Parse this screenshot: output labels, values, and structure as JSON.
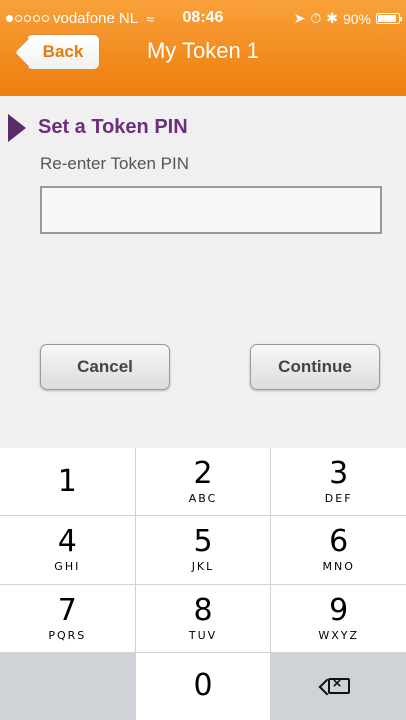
{
  "status_bar": {
    "carrier": "vodafone NL",
    "time": "08:46",
    "battery": "90%",
    "signal_filled": 1,
    "signal_total": 5,
    "icons": [
      "wifi-icon",
      "location-arrow-icon",
      "alarm-icon",
      "bluetooth-icon",
      "battery-icon"
    ]
  },
  "nav": {
    "back_label": "Back",
    "title": "My Token 1"
  },
  "form": {
    "section_title": "Set a Token PIN",
    "field_label": "Re-enter Token PIN",
    "pin_value": "",
    "cancel_label": "Cancel",
    "continue_label": "Continue"
  },
  "keypad": {
    "keys": [
      {
        "digit": "1",
        "letters": ""
      },
      {
        "digit": "2",
        "letters": "ABC"
      },
      {
        "digit": "3",
        "letters": "DEF"
      },
      {
        "digit": "4",
        "letters": "GHI"
      },
      {
        "digit": "5",
        "letters": "JKL"
      },
      {
        "digit": "6",
        "letters": "MNO"
      },
      {
        "digit": "7",
        "letters": "PQRS"
      },
      {
        "digit": "8",
        "letters": "TUV"
      },
      {
        "digit": "9",
        "letters": "WXYZ"
      },
      {
        "digit": "0",
        "letters": ""
      }
    ]
  },
  "colors": {
    "header_orange": "#f28b1e",
    "section_purple": "#6b2f7b",
    "marker_purple": "#5b2a68"
  }
}
